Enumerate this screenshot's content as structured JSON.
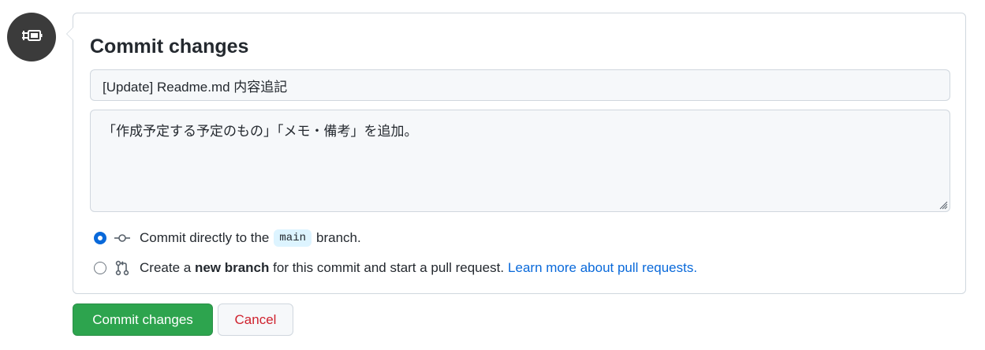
{
  "avatar": {
    "icon": "plug-icon",
    "bg_color": "#3b3b3b"
  },
  "commit_panel": {
    "title": "Commit changes",
    "summary_value": "[Update] Readme.md 内容追記",
    "description_value": "「作成予定する予定のもの」「メモ・備考」を追加。",
    "options": {
      "direct": {
        "selected": true,
        "text_before": "Commit directly to the",
        "branch": "main",
        "text_after": "branch."
      },
      "new_branch": {
        "selected": false,
        "text_before": "Create a",
        "bold": "new branch",
        "text_after": "for this commit and start a pull request.",
        "link": "Learn more about pull requests."
      }
    }
  },
  "buttons": {
    "commit_label": "Commit changes",
    "cancel_label": "Cancel"
  },
  "colors": {
    "primary": "#2da44e",
    "link": "#0969da",
    "danger": "#cf222e",
    "border": "#d0d7de"
  }
}
